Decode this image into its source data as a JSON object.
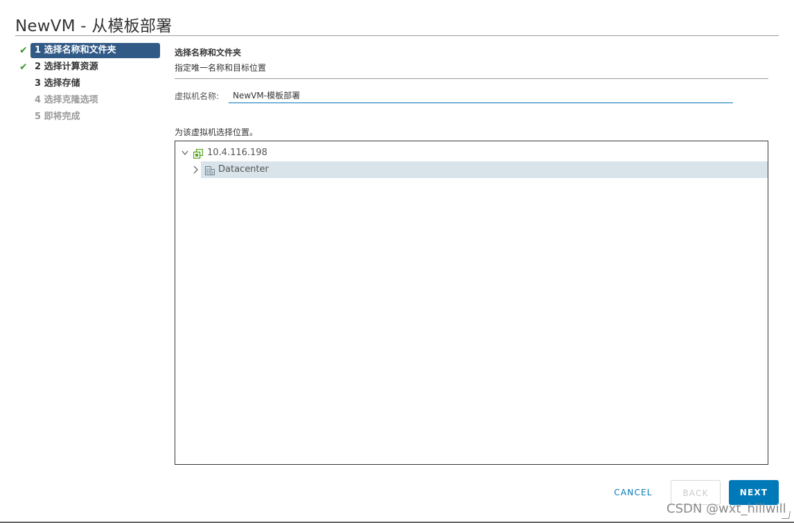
{
  "dialog": {
    "title": "NewVM - 从模板部署"
  },
  "steps": [
    {
      "label": "1 选择名称和文件夹",
      "state": "active",
      "checked": true
    },
    {
      "label": "2 选择计算资源",
      "state": "done",
      "checked": true
    },
    {
      "label": "3 选择存储",
      "state": "current",
      "checked": false
    },
    {
      "label": "4 选择克隆选项",
      "state": "disabled",
      "checked": false
    },
    {
      "label": "5 即将完成",
      "state": "disabled",
      "checked": false
    }
  ],
  "main": {
    "section_title": "选择名称和文件夹",
    "section_subtitle": "指定唯一名称和目标位置",
    "vm_name_label": "虚拟机名称:",
    "vm_name_value": "NewVM-模板部署",
    "location_label": "为该虚拟机选择位置。"
  },
  "tree": {
    "nodes": [
      {
        "label": "10.4.116.198",
        "icon": "vcenter-icon",
        "expanded": true
      },
      {
        "label": "Datacenter",
        "icon": "datacenter-icon",
        "expanded": false,
        "selected": true
      }
    ]
  },
  "footer": {
    "cancel_label": "CANCEL",
    "back_label": "BACK",
    "next_label": "NEXT"
  },
  "watermark": "CSDN @wxt_hillwill",
  "colors": {
    "accent": "#0079b8",
    "active_step_bg": "#315a86",
    "check": "#3a9a2c",
    "selected_row": "#d8e3ea",
    "vcenter_icon": "#5aa329"
  },
  "icons": {
    "check": "✔",
    "caret_down": "⌄",
    "caret_right": "›"
  }
}
